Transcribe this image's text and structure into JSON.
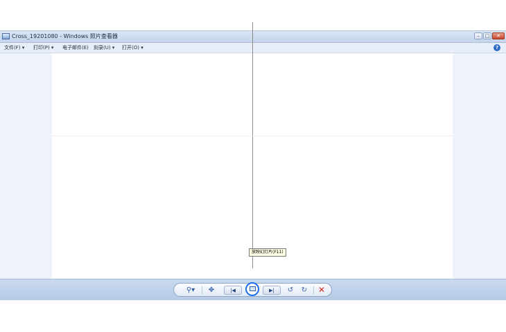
{
  "window": {
    "title": "Cross_19201080 - Windows 照片查看器",
    "controls": {
      "minimize": "–",
      "maximize": "□",
      "close": "✕"
    }
  },
  "menubar": {
    "items": [
      {
        "label": "文件(F) ▾"
      },
      {
        "label": "打印(P) ▾"
      },
      {
        "label": "电子邮件(E)"
      },
      {
        "label": "刻录(U) ▾"
      },
      {
        "label": "打开(O) ▾"
      }
    ],
    "help": "?"
  },
  "toolbar": {
    "zoom": "⚲▾",
    "fit": "✥",
    "previous": "|◀",
    "next": "▶|",
    "rotate_ccw": "↺",
    "rotate_cw": "↻",
    "delete": "✕"
  },
  "tooltip": {
    "text": "放映幻灯片(F11)"
  },
  "icons": {
    "app": "photo-viewer-icon",
    "help": "help-icon",
    "zoom": "magnifier-icon",
    "fit": "actual-size-icon",
    "previous": "previous-icon",
    "slideshow": "slideshow-icon",
    "next": "next-icon",
    "rotate_ccw": "rotate-counterclockwise-icon",
    "rotate_cw": "rotate-clockwise-icon",
    "delete": "delete-icon"
  },
  "colors": {
    "title_bar": "#c3d4ec",
    "close_button": "#c7452c",
    "control_bar": "#b7cbe6",
    "slideshow_focus": "#1b6ff0",
    "delete": "#d02a1c"
  }
}
